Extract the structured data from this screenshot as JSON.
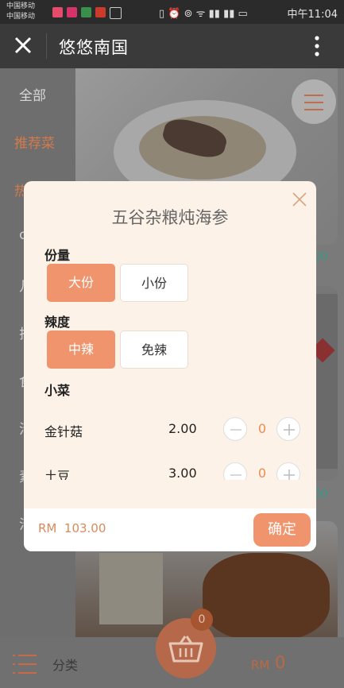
{
  "status_bar": {
    "carrier1": "中国移动",
    "carrier2": "中国移动",
    "time": "中午11:04"
  },
  "header": {
    "title": "悠悠南国",
    "close_icon": "close-icon",
    "menu_icon": "more-vert-icon"
  },
  "sidebar": {
    "categories": [
      "全部",
      "推荐菜",
      "热",
      "c",
      "几",
      "排",
      "食",
      "汁",
      "素",
      "汁"
    ],
    "selected_color": "#ef8a50"
  },
  "cards": [
    {
      "price_fragment": "00"
    },
    {
      "price_fragment": "00"
    }
  ],
  "modal": {
    "title": "五谷杂粮炖海参",
    "close_icon": "close-icon",
    "portion": {
      "label": "份量",
      "options": [
        "大份",
        "小份"
      ],
      "selected": "大份"
    },
    "spice": {
      "label": "辣度",
      "options": [
        "中辣",
        "免辣"
      ],
      "selected": "中辣"
    },
    "sides": {
      "label": "小菜",
      "items": [
        {
          "name": "金针菇",
          "price": "2.00",
          "qty": "0"
        },
        {
          "name": "土豆",
          "price": "3.00",
          "qty": "0"
        }
      ]
    },
    "total": "RM  103.00",
    "confirm_label": "确定"
  },
  "bottom_bar": {
    "category_label": "分类",
    "cart_count": "0",
    "total_currency": "RM",
    "total_value": "0"
  },
  "colors": {
    "accent": "#ef946c",
    "accent_text": "#ef8a50",
    "teal": "#3a9a8a"
  }
}
